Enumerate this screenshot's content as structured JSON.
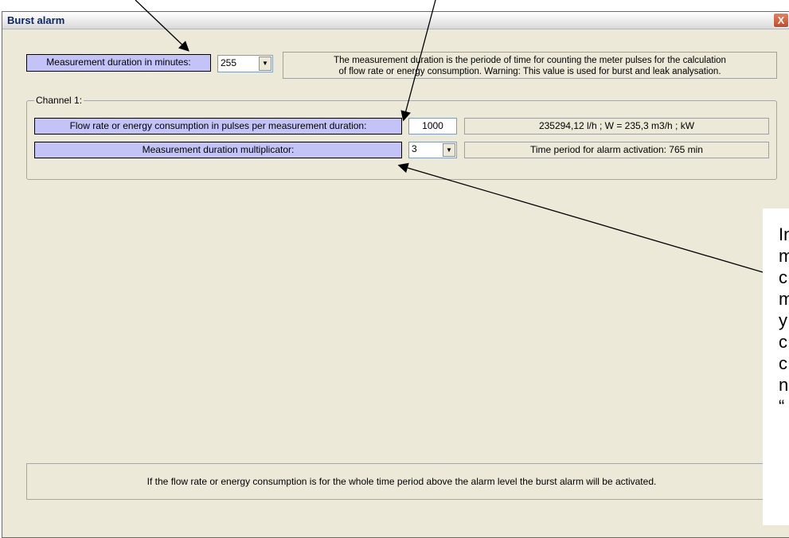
{
  "dialog": {
    "title": "Burst alarm",
    "close_glyph": "X"
  },
  "measurement": {
    "label": "Measurement duration in minutes:",
    "value": "255",
    "info_line1": "The measurement duration is the periode of time for counting the meter pulses for the calculation",
    "info_line2": "of flow rate or energy consumption. Warning: This value is used for burst and leak analysation."
  },
  "channel": {
    "title": "Channel 1:",
    "flow_label": "Flow rate or energy consumption in pulses per measurement duration:",
    "flow_value": "1000",
    "flow_result": "235294,12  l/h ; W  =  235,3  m3/h ; kW",
    "multiplicator_label": "Measurement duration multiplicator:",
    "multiplicator_value": "3",
    "period_text": "Time period for alarm activation: 765 min"
  },
  "footer": {
    "text": "If the flow rate or energy consumption is for the whole time period above the alarm level the burst alarm will be activated."
  },
  "callout": {
    "letters": [
      "In",
      "m",
      "c",
      "m",
      "y",
      "c",
      "c",
      "n",
      "“"
    ]
  },
  "icons": {
    "dropdown": "chevron-down-icon",
    "close": "close-icon"
  }
}
